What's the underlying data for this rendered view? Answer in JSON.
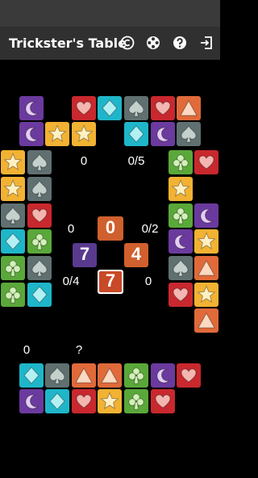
{
  "app": {
    "title": "Trickster's Table"
  },
  "toolbar": [
    {
      "name": "copyright-icon"
    },
    {
      "name": "settings-icon"
    },
    {
      "name": "help-icon"
    },
    {
      "name": "exit-icon"
    }
  ],
  "colors": {
    "purple": "#6b3a9e",
    "red": "#c8282e",
    "teal": "#1fb6c9",
    "grey": "#607070",
    "orange": "#e06a3a",
    "yellow": "#f2b233",
    "green": "#5aa83a"
  },
  "suits": {
    "moon": {
      "bg": "#6b3a9e",
      "fg": "#e4cdf2"
    },
    "heart": {
      "bg": "#c8282e",
      "fg": "#f3b6b0"
    },
    "diamond": {
      "bg": "#1fb6c9",
      "fg": "#b3f0f3"
    },
    "spade": {
      "bg": "#607070",
      "fg": "#c4d0cc"
    },
    "tri": {
      "bg": "#e06a3a",
      "fg": "#fbd9c2"
    },
    "star": {
      "bg": "#f2b233",
      "fg": "#fff0c2"
    },
    "clover": {
      "bg": "#5aa83a",
      "fg": "#d2f0b8"
    }
  },
  "players": {
    "top": {
      "tricks": "0",
      "bid": "0/5"
    },
    "left": {
      "tricks": "0",
      "bid": "0/4"
    },
    "right": {
      "tricks": "0/2",
      "bid": "0"
    },
    "bottom": {
      "tricks": "0",
      "bid": "?"
    }
  },
  "hands": {
    "top_row1": [
      "moon",
      "heart",
      "diamond",
      "spade",
      "heart",
      "tri"
    ],
    "top_row2": [
      "moon",
      "star",
      "star",
      "diamond",
      "moon",
      "spade"
    ],
    "left_col1": [
      "star",
      "star",
      "spade",
      "diamond",
      "clover",
      "clover"
    ],
    "left_col2": [
      "spade",
      "spade",
      "heart",
      "clover",
      "spade",
      "diamond"
    ],
    "right_col1": [
      "clover",
      "star",
      "clover",
      "moon",
      "spade",
      "heart"
    ],
    "right_col2": [
      "heart",
      "moon",
      "star",
      "tri",
      "star",
      "tri"
    ],
    "bottom_row1": [
      "diamond",
      "spade",
      "tri",
      "tri",
      "clover",
      "moon",
      "heart"
    ],
    "bottom_row2": [
      "moon",
      "diamond",
      "heart",
      "star",
      "clover",
      "heart"
    ]
  },
  "center": {
    "top": {
      "value": "0",
      "color": "#d0602e"
    },
    "left": {
      "value": "7",
      "color": "#5a3a8e"
    },
    "right": {
      "value": "4",
      "color": "#d0602e"
    },
    "bottom": {
      "value": "7",
      "color": "#c84a28"
    }
  }
}
